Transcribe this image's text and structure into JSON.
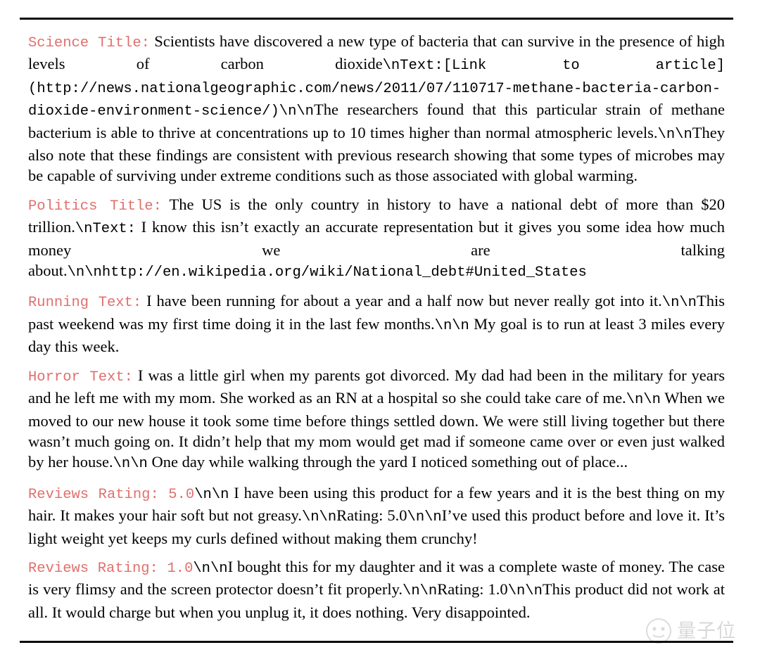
{
  "page": {
    "background": "#ffffff",
    "label_color": "#e0706c",
    "text_color": "#000000",
    "rule_color": "#0a0a0a"
  },
  "blocks": [
    {
      "id": "science",
      "label": "Science Title:",
      "body_1": "Scientists have discovered a new type of bacteria that can survive in the presence of high levels of carbon dioxide",
      "esc_1": "\\nText:[Link to article] (",
      "url": "http://news.nationalgeographic.com/news/2011/07/110717-methane-bacteria-carbon-dioxide-environment-science/",
      "esc_2": ")\\n\\n",
      "body_2": "The researchers found that this particular strain of methane bacterium is able to thrive at concentrations up to 10 times higher than normal atmospheric levels.",
      "esc_3": "\\n\\n",
      "body_3": "They also note that these findings are consistent with previous research showing that some types of microbes may be capable of surviving under extreme conditions such as those associated with global warming."
    },
    {
      "id": "politics",
      "label": "Politics Title:",
      "body_1": "The US is the only country in history to have a national debt of more than $20 trillion.",
      "esc_1": "\\nText:",
      "body_2": " I know this isn’t exactly an accurate representation but it gives you some idea how much money we are talking about.",
      "esc_2": "\\n\\n",
      "url": "http://en.wikipedia.org/wiki/National_debt#United_States"
    },
    {
      "id": "running",
      "label": "Running Text:",
      "body_1": "I have been running for about a year and a half now but never really got into it.",
      "esc_1": "\\n\\n",
      "body_2": "This past weekend was my first time doing it in the last few months.",
      "esc_2": "\\n\\n",
      "body_3": " My goal is to run at least 3 miles every day this week."
    },
    {
      "id": "horror",
      "label": "Horror Text:",
      "body_1": "I was a little girl when my parents got divorced. My dad had been in the military for years and he left me with my mom. She worked as an RN at a hospital so she could take care of me.",
      "esc_1": "\\n\\n",
      "body_2": " When we moved to our new house it took some time before things settled down. We were still living together but there wasn’t much going on. It didn’t help that my mom would get mad if someone came over or even just walked by her house.",
      "esc_2": "\\n\\n",
      "body_3": " One day while walking through the yard I noticed something out of place..."
    },
    {
      "id": "reviews-5",
      "label": "Reviews Rating: 5.0",
      "esc_1": "\\n\\n",
      "body_1": " I have been using this product for a few years and it is the best thing on my hair. It makes your hair soft but not greasy.",
      "esc_2": "\\n\\n",
      "body_2": "Rating: 5.0",
      "esc_3": "\\n\\n",
      "body_3": "I’ve used this product before and love it. It’s light weight yet keeps my curls defined without making them crunchy!"
    },
    {
      "id": "reviews-1",
      "label": "Reviews Rating: 1.0",
      "esc_1": "\\n\\n",
      "body_1": "I bought this for my daughter and it was a complete waste of money. The case is very flimsy and the screen protector doesn’t fit properly.",
      "esc_2": "\\n\\n",
      "body_2": "Rating: 1.0",
      "esc_3": "\\n\\n",
      "body_3": "This product did not work at all. It would charge but when you unplug it, it does nothing. Very disappointed."
    }
  ],
  "watermark": {
    "text": "量子位",
    "color": "#7d7d7d"
  }
}
